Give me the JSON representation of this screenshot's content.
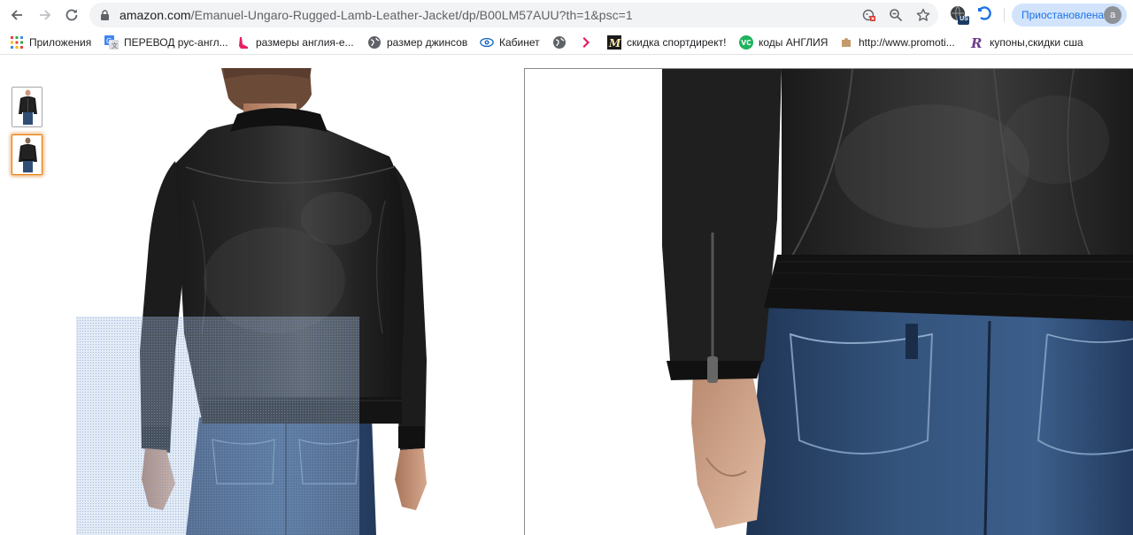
{
  "browser": {
    "url_domain": "amazon.com",
    "url_path": "/Emanuel-Ungaro-Rugged-Lamb-Leather-Jacket/dp/B00LM57AUU?th=1&psc=1",
    "profile_status": "Приостановлена",
    "profile_initial": "a",
    "extension_badge": "US"
  },
  "bookmarks": [
    {
      "label": "Приложения",
      "icon": "apps-grid-icon"
    },
    {
      "label": "ПЕРЕВОД рус-англ...",
      "icon": "google-translate-icon"
    },
    {
      "label": "размеры англия-е...",
      "icon": "shoe-icon"
    },
    {
      "label": "размер джинсов",
      "icon": "globe-icon"
    },
    {
      "label": "Кабинет",
      "icon": "eye-icon"
    },
    {
      "label": "",
      "icon": "globe-icon"
    },
    {
      "label": "",
      "icon": "arrow-logo-icon"
    },
    {
      "label": "скидка спортдирект!",
      "icon": "m-logo-icon"
    },
    {
      "label": "коды АНГЛИЯ",
      "icon": "vc-logo-icon"
    },
    {
      "label": "http://www.promoti...",
      "icon": "puzzle-icon"
    },
    {
      "label": "купоны,скидки сша",
      "icon": "r-logo-icon"
    }
  ],
  "product": {
    "thumbnails": [
      {
        "name": "front-view",
        "selected": false
      },
      {
        "name": "back-view",
        "selected": true
      }
    ]
  },
  "colors": {
    "accent": "#1a73e8",
    "thumb_selected": "#e77600",
    "jacket": "#1c1c1c",
    "denim": "#2e4a6e"
  }
}
